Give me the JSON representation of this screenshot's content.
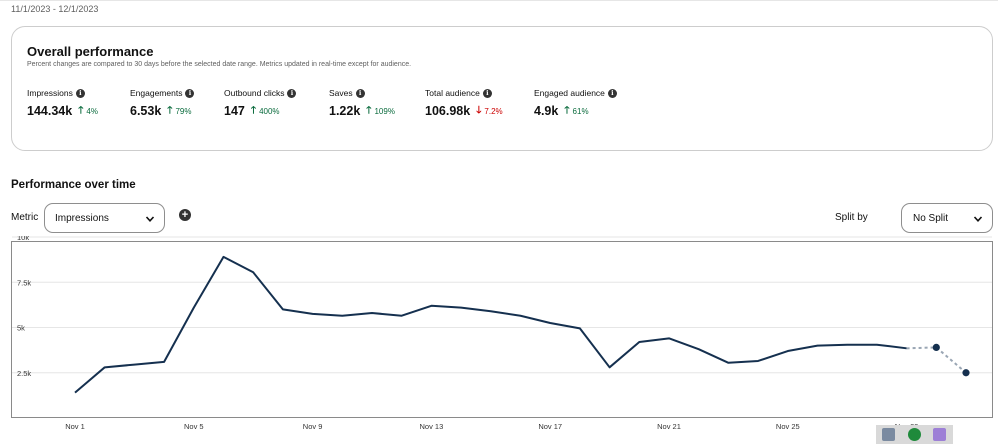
{
  "date_range": "11/1/2023 - 12/1/2023",
  "overall": {
    "title": "Overall performance",
    "subtitle": "Percent changes are compared to 30 days before the selected date range. Metrics updated in real-time except for audience.",
    "metrics": [
      {
        "label": "Impressions",
        "value": "144.34k",
        "change": "4%",
        "direction": "up"
      },
      {
        "label": "Engagements",
        "value": "6.53k",
        "change": "79%",
        "direction": "up"
      },
      {
        "label": "Outbound clicks",
        "value": "147",
        "change": "400%",
        "direction": "up"
      },
      {
        "label": "Saves",
        "value": "1.22k",
        "change": "109%",
        "direction": "up"
      },
      {
        "label": "Total audience",
        "value": "106.98k",
        "change": "7.2%",
        "direction": "down"
      },
      {
        "label": "Engaged audience",
        "value": "4.9k",
        "change": "61%",
        "direction": "up"
      }
    ]
  },
  "performance": {
    "title": "Performance over time",
    "metric_label": "Metric",
    "metric_selected": "Impressions",
    "split_label": "Split by",
    "split_selected": "No Split"
  },
  "colors": {
    "line": "#15304f",
    "up": "#0a6b3d",
    "down": "#cc0000",
    "grid": "#e6e6e6"
  },
  "icons": {
    "info": "info-icon",
    "add": "add-circle-icon",
    "dropdown": "chevron-down-icon"
  },
  "chart_data": {
    "type": "line",
    "title": "",
    "xlabel": "",
    "ylabel": "",
    "ylim": [
      0,
      10000
    ],
    "yticks": [
      2500,
      5000,
      7500,
      10000
    ],
    "ytick_labels": [
      "2.5k",
      "5k",
      "7.5k",
      "10k"
    ],
    "xtick_labels": [
      "Nov 1",
      "Nov 5",
      "Nov 9",
      "Nov 13",
      "Nov 17",
      "Nov 21",
      "Nov 25",
      "Nov 29"
    ],
    "x": [
      1,
      2,
      3,
      4,
      5,
      6,
      7,
      8,
      9,
      10,
      11,
      12,
      13,
      14,
      15,
      16,
      17,
      18,
      19,
      20,
      21,
      22,
      23,
      24,
      25,
      26,
      27,
      28,
      29,
      30,
      31
    ],
    "series": [
      {
        "values": [
          1400,
          2800,
          2950,
          3100,
          6100,
          8900,
          8050,
          6000,
          5750,
          5650,
          5800,
          5650,
          6200,
          6100,
          5900,
          5650,
          5250,
          4950,
          2800,
          4200,
          4400,
          3800,
          3050,
          3150,
          3700,
          4000,
          4050,
          4050,
          3850,
          3900,
          2500
        ],
        "style": "solid",
        "dashed_from_index": 28,
        "marker_indices": [
          29,
          30
        ]
      }
    ],
    "grid": true
  }
}
